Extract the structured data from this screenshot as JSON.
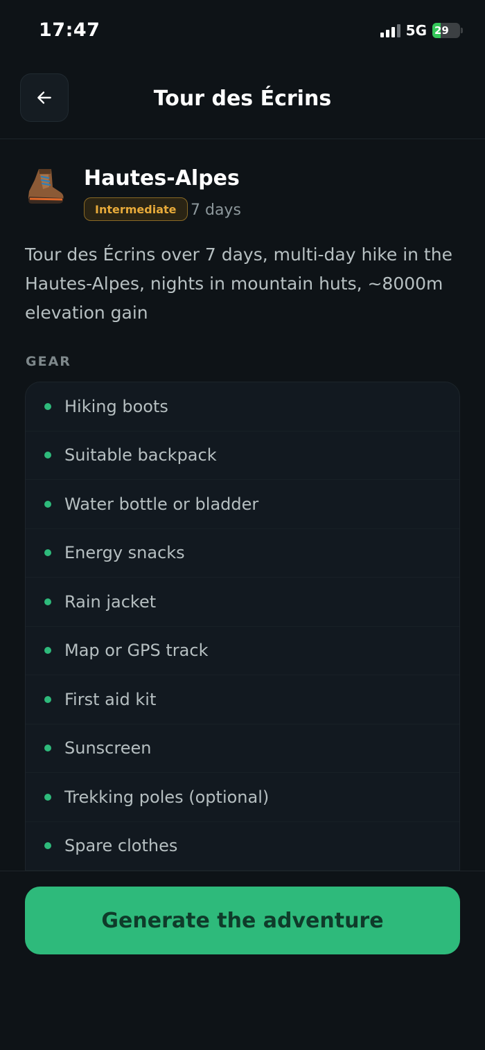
{
  "status": {
    "time": "17:47",
    "network": "5G",
    "battery_level": "29",
    "battery_fraction": 0.29
  },
  "header": {
    "title": "Tour des Écrins"
  },
  "trip": {
    "region": "Hautes-Alpes",
    "level": "Intermediate",
    "duration": "7 days",
    "description": "Tour des Écrins over 7 days, multi-day hike in the Hautes-Alpes, nights in mountain huts, ~8000m elevation gain"
  },
  "gear": {
    "label": "GEAR",
    "items": [
      "Hiking boots",
      "Suitable backpack",
      "Water bottle or bladder",
      "Energy snacks",
      "Rain jacket",
      "Map or GPS track",
      "First aid kit",
      "Sunscreen",
      "Trekking poles (optional)",
      "Spare clothes"
    ]
  },
  "actions": {
    "generate_label": "Generate the adventure"
  },
  "colors": {
    "accent": "#2eba7b",
    "badge_text": "#e7aa3a",
    "background": "#0e1317"
  },
  "icons": {
    "back": "arrow-left-icon",
    "region": "hiking-boot-icon"
  }
}
